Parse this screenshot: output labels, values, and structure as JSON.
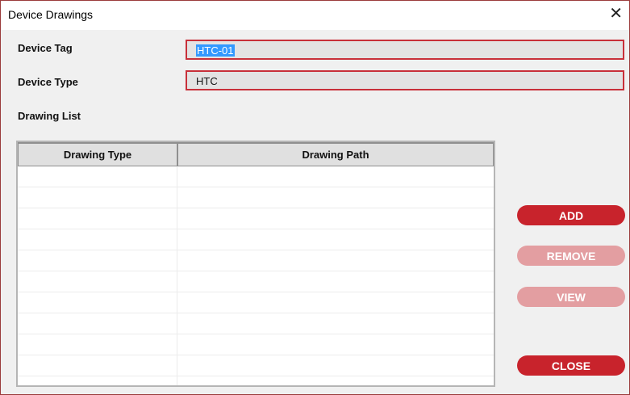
{
  "window": {
    "title": "Device Drawings",
    "close_glyph": "✕"
  },
  "form": {
    "device_tag_label": "Device Tag",
    "device_tag_value": "HTC-01",
    "device_type_label": "Device Type",
    "device_type_value": "HTC",
    "drawing_list_label": "Drawing List"
  },
  "table": {
    "columns": [
      "Drawing Type",
      "Drawing Path"
    ],
    "rows": []
  },
  "buttons": {
    "add": "ADD",
    "remove": "REMOVE",
    "view": "VIEW",
    "close": "CLOSE"
  },
  "colors": {
    "accent": "#c8232c",
    "accent_disabled": "#e39ea1",
    "field_border": "#c8303a",
    "selection": "#3399ff"
  }
}
